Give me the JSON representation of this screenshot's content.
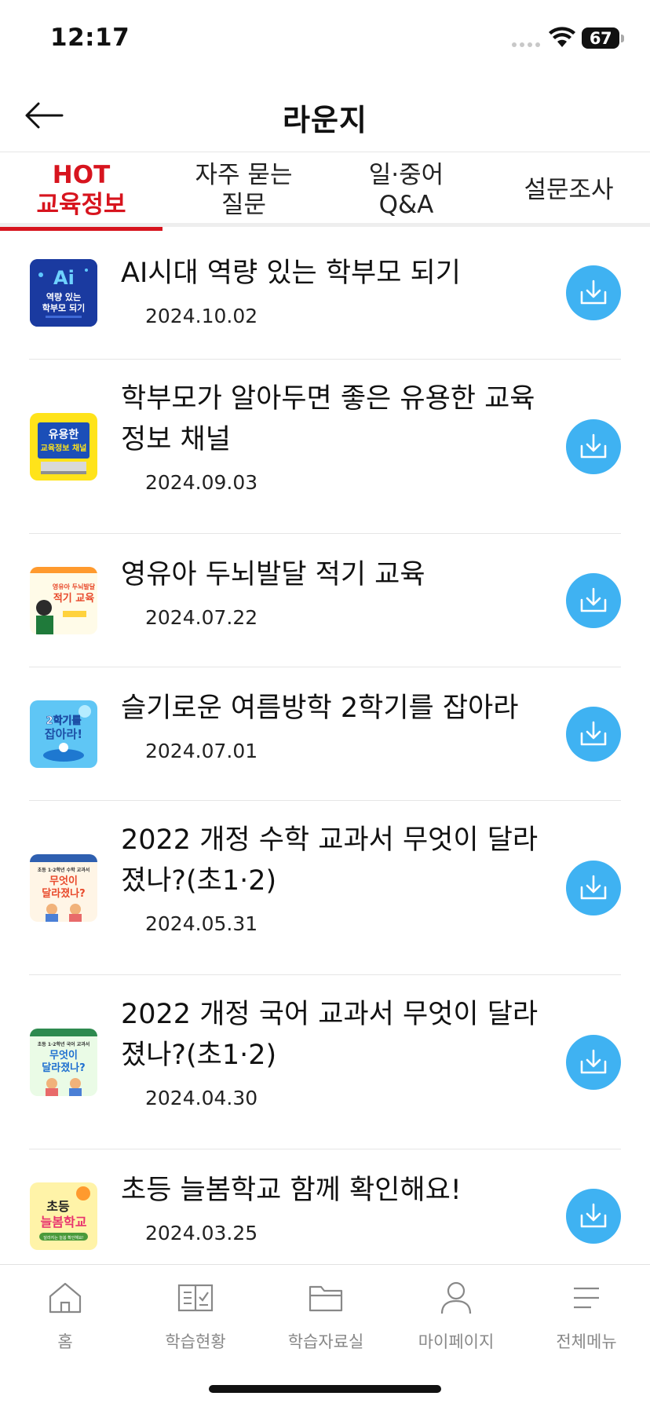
{
  "status_bar": {
    "time": "12:17",
    "battery": "67"
  },
  "header": {
    "title": "라운지"
  },
  "tabs": [
    {
      "line1": "HOT",
      "line2": "교육정보",
      "active": true
    },
    {
      "line1": "자주 묻는",
      "line2": "질문",
      "active": false
    },
    {
      "line1": "일·중어",
      "line2": "Q&A",
      "active": false
    },
    {
      "line1": "설문조사",
      "line2": "",
      "active": false
    }
  ],
  "items": [
    {
      "title": "AI시대 역량 있는 학부모 되기",
      "date": "2024.10.02",
      "thumb_text": [
        "Ai",
        "역량 있는",
        "학부모 되기"
      ]
    },
    {
      "title": "학부모가 알아두면 좋은 유용한 교육 정보 채널",
      "date": "2024.09.03",
      "thumb_text": [
        "유용한",
        "교육정보 채널"
      ]
    },
    {
      "title": "영유아 두뇌발달 적기 교육",
      "date": "2024.07.22",
      "thumb_text": [
        "영유아 두뇌발달",
        "적기 교육"
      ]
    },
    {
      "title": "슬기로운 여름방학 2학기를 잡아라",
      "date": "2024.07.01",
      "thumb_text": [
        "2학기를",
        "잡아라!"
      ]
    },
    {
      "title": "2022 개정 수학 교과서 무엇이 달라졌나?(초1·2)",
      "date": "2024.05.31",
      "thumb_text": [
        "초등 1·2학년 수학 교과서",
        "무엇이",
        "달라졌나?"
      ]
    },
    {
      "title": "2022 개정 국어 교과서 무엇이 달라졌나?(초1·2)",
      "date": "2024.04.30",
      "thumb_text": [
        "초등 1·2학년 국어 교과서",
        "무엇이",
        "달라졌나?"
      ]
    },
    {
      "title": "초등 늘봄학교 함께 확인해요!",
      "date": "2024.03.25",
      "thumb_text": [
        "초등",
        "늘봄학교",
        "달라지는 늘봄 확인해요!"
      ]
    }
  ],
  "bottom_nav": [
    {
      "label": "홈",
      "icon": "home-icon"
    },
    {
      "label": "학습현황",
      "icon": "book-check-icon"
    },
    {
      "label": "학습자료실",
      "icon": "folder-icon"
    },
    {
      "label": "마이페이지",
      "icon": "person-icon"
    },
    {
      "label": "전체메뉴",
      "icon": "menu-icon"
    }
  ],
  "colors": {
    "accent": "#d7141e",
    "download_button": "#3fb2f2"
  }
}
